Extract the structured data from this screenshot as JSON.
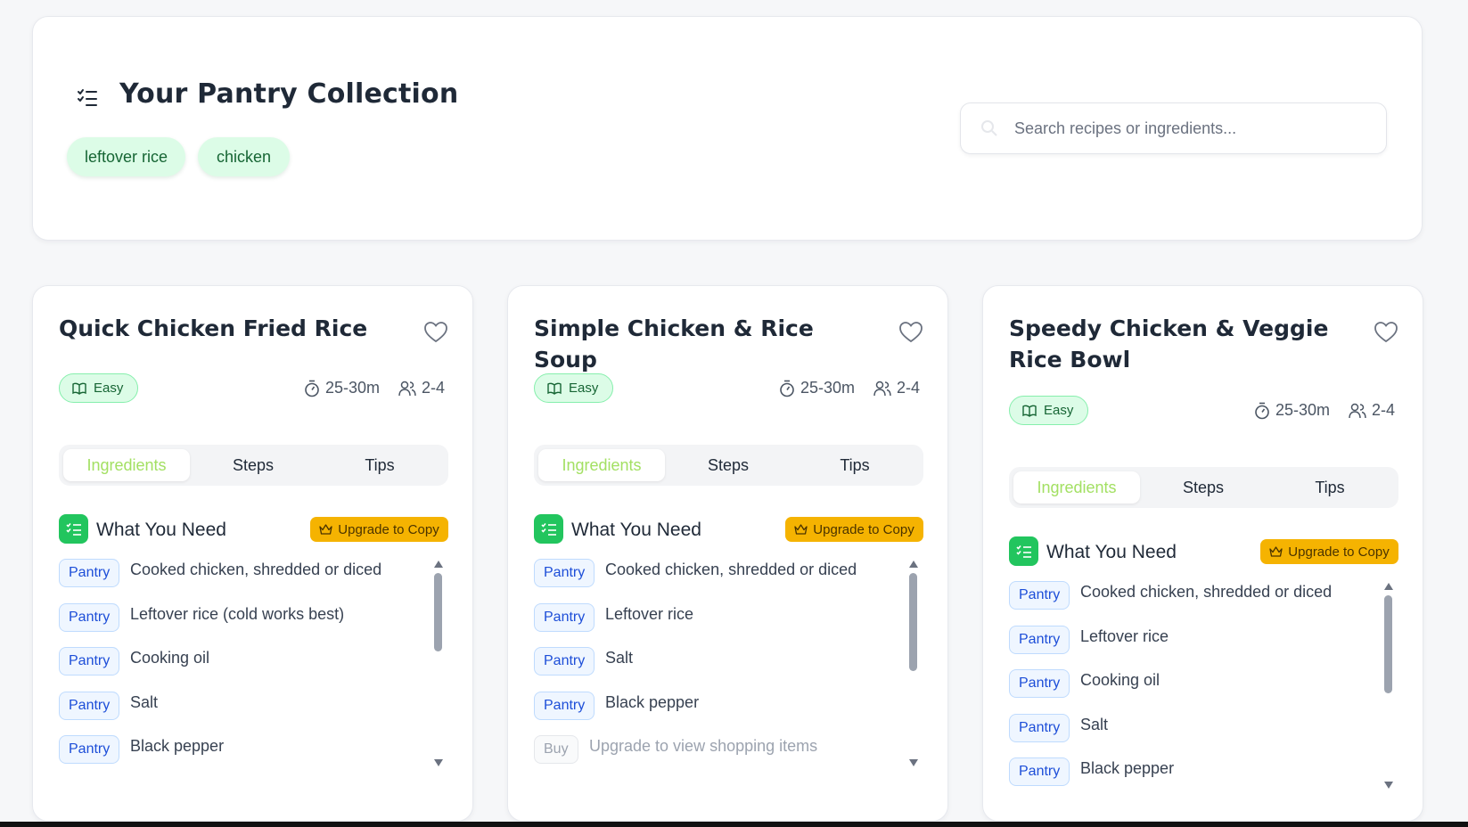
{
  "header": {
    "title": "Your Pantry Collection",
    "chips": [
      "leftover rice",
      "chicken"
    ],
    "search_placeholder": "Search recipes or ingredients..."
  },
  "icons": {
    "header_icon": "list-check-icon",
    "search": "search-icon",
    "favorite": "heart-icon",
    "difficulty": "book-open-icon",
    "time": "timer-icon",
    "servings": "users-icon",
    "section": "list-check-icon",
    "upgrade": "crown-icon"
  },
  "colors": {
    "accent_green": "#22c55e",
    "chip_bg": "#dcfce7",
    "upgrade_yellow": "#f5b301",
    "active_tab": "#a3e063",
    "pantry_tag": "#1d4ed8"
  },
  "recipes": [
    {
      "title": "Quick Chicken Fried Rice",
      "difficulty": "Easy",
      "time": "25-30m",
      "servings": "2-4",
      "tabs": [
        "Ingredients",
        "Steps",
        "Tips"
      ],
      "active_tab": "Ingredients",
      "section_label": "What You Need",
      "upgrade_label": "Upgrade to Copy",
      "ingredients": [
        {
          "tag": "Pantry",
          "text": "Cooked chicken, shredded or diced"
        },
        {
          "tag": "Pantry",
          "text": "Leftover rice (cold works best)"
        },
        {
          "tag": "Pantry",
          "text": "Cooking oil"
        },
        {
          "tag": "Pantry",
          "text": "Salt"
        },
        {
          "tag": "Pantry",
          "text": "Black pepper"
        }
      ]
    },
    {
      "title": "Simple Chicken & Rice Soup",
      "difficulty": "Easy",
      "time": "25-30m",
      "servings": "2-4",
      "tabs": [
        "Ingredients",
        "Steps",
        "Tips"
      ],
      "active_tab": "Ingredients",
      "section_label": "What You Need",
      "upgrade_label": "Upgrade to Copy",
      "ingredients": [
        {
          "tag": "Pantry",
          "text": "Cooked chicken, shredded or diced"
        },
        {
          "tag": "Pantry",
          "text": "Leftover rice"
        },
        {
          "tag": "Pantry",
          "text": "Salt"
        },
        {
          "tag": "Pantry",
          "text": "Black pepper"
        },
        {
          "tag": "Buy",
          "text": "Upgrade to view shopping items"
        }
      ]
    },
    {
      "title": "Speedy Chicken & Veggie Rice Bowl",
      "difficulty": "Easy",
      "time": "25-30m",
      "servings": "2-4",
      "tabs": [
        "Ingredients",
        "Steps",
        "Tips"
      ],
      "active_tab": "Ingredients",
      "section_label": "What You Need",
      "upgrade_label": "Upgrade to Copy",
      "ingredients": [
        {
          "tag": "Pantry",
          "text": "Cooked chicken, shredded or diced"
        },
        {
          "tag": "Pantry",
          "text": "Leftover rice"
        },
        {
          "tag": "Pantry",
          "text": "Cooking oil"
        },
        {
          "tag": "Pantry",
          "text": "Salt"
        },
        {
          "tag": "Pantry",
          "text": "Black pepper"
        }
      ]
    }
  ]
}
